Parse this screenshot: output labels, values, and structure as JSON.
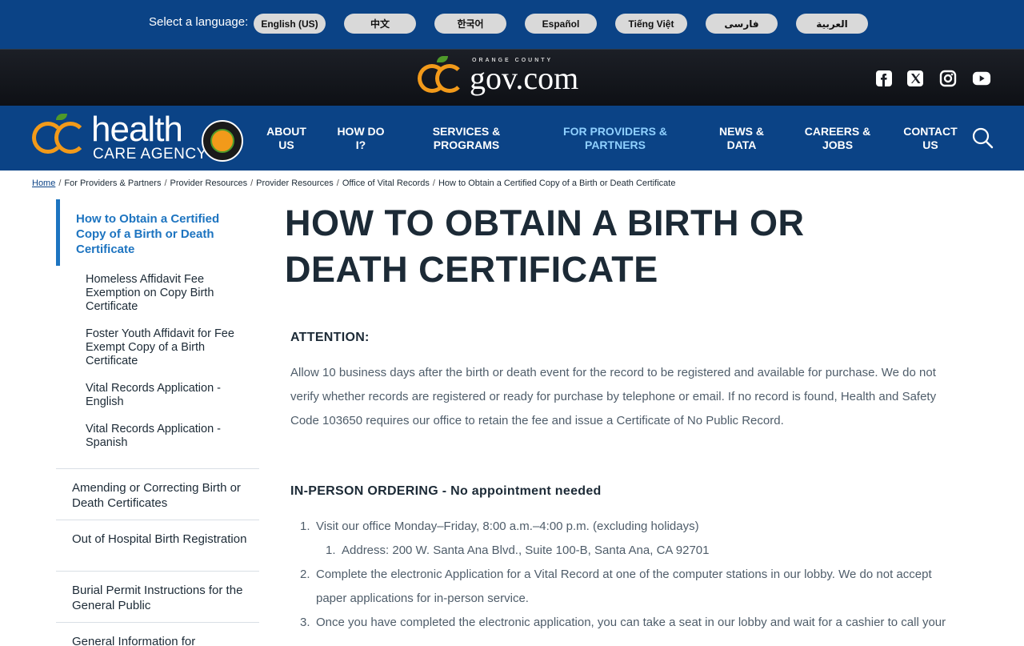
{
  "language_bar": {
    "label": "Select a language:",
    "languages": [
      "English (US)",
      "中文",
      "한국어",
      "Español",
      "Tiếng Việt",
      "فارسی",
      "العربية"
    ]
  },
  "gov_header": {
    "logo_small_text": "ORANGE COUNTY",
    "logo_domain": "gov.com",
    "social_icons": [
      "facebook-icon",
      "x-icon",
      "instagram-icon",
      "youtube-icon"
    ]
  },
  "main_nav": {
    "logo_line1": "health",
    "logo_line2": "CARE AGENCY",
    "items": [
      {
        "label": "ABOUT\nUS"
      },
      {
        "label": "HOW DO\nI?"
      },
      {
        "label": "SERVICES &\nPROGRAMS"
      },
      {
        "label": "FOR PROVIDERS &\nPARTNERS"
      },
      {
        "label": "NEWS &\nDATA"
      },
      {
        "label": "CAREERS &\nJOBS"
      },
      {
        "label": "CONTACT\nUS"
      }
    ],
    "search_icon": "search-icon"
  },
  "breadcrumb": {
    "items": [
      "Home",
      "For Providers & Partners",
      "Provider Resources",
      "Provider Resources",
      "Office of Vital Records",
      "How to Obtain a Certified Copy of a Birth or Death Certificate"
    ]
  },
  "sidebar": {
    "active": "How to Obtain a Certified Copy of a Birth or Death Certificate",
    "subitems": [
      "Homeless Affidavit Fee Exemption on Copy Birth Certificate",
      "Foster Youth Affidavit for Fee Exempt Copy of a Birth Certificate",
      "Vital Records Application - English",
      "Vital Records Application - Spanish"
    ],
    "items": [
      "Amending or Correcting Birth or Death Certificates",
      "Out of Hospital Birth Registration",
      "Burial Permit Instructions for the General Public",
      "General Information for"
    ]
  },
  "content": {
    "title": "HOW TO OBTAIN A BIRTH OR DEATH CERTIFICATE",
    "attention_heading": "ATTENTION:",
    "attention_text": "Allow 10 business days after the birth or death event for the record to be registered and available for purchase. We do not verify whether records are registered or ready for purchase by telephone or email.  If no record is found, Health and Safety Code 103650 requires our office to retain the fee and issue a Certificate of No Public Record.",
    "inperson_heading": "IN-PERSON ORDERING - No appointment needed",
    "steps": [
      {
        "num": "1.",
        "text": "Visit our office Monday–Friday, 8:00 a.m.–4:00 p.m. (excluding holidays)"
      },
      {
        "num": "1.",
        "text": "Address: 200 W. Santa Ana Blvd., Suite 100-B, Santa Ana, CA 92701"
      },
      {
        "num": "2.",
        "text": "Complete the electronic Application for a Vital Record at one of the computer stations in our lobby. We do not accept"
      },
      {
        "num": "",
        "text": "paper applications for in-person service."
      },
      {
        "num": "3.",
        "text": "Once you have completed the electronic application, you can take a seat in our lobby and wait for a cashier to call your"
      }
    ]
  },
  "colors": {
    "brand_blue": "#0b4386",
    "accent_orange": "#f29a1a",
    "link_blue": "#1d74c0"
  }
}
